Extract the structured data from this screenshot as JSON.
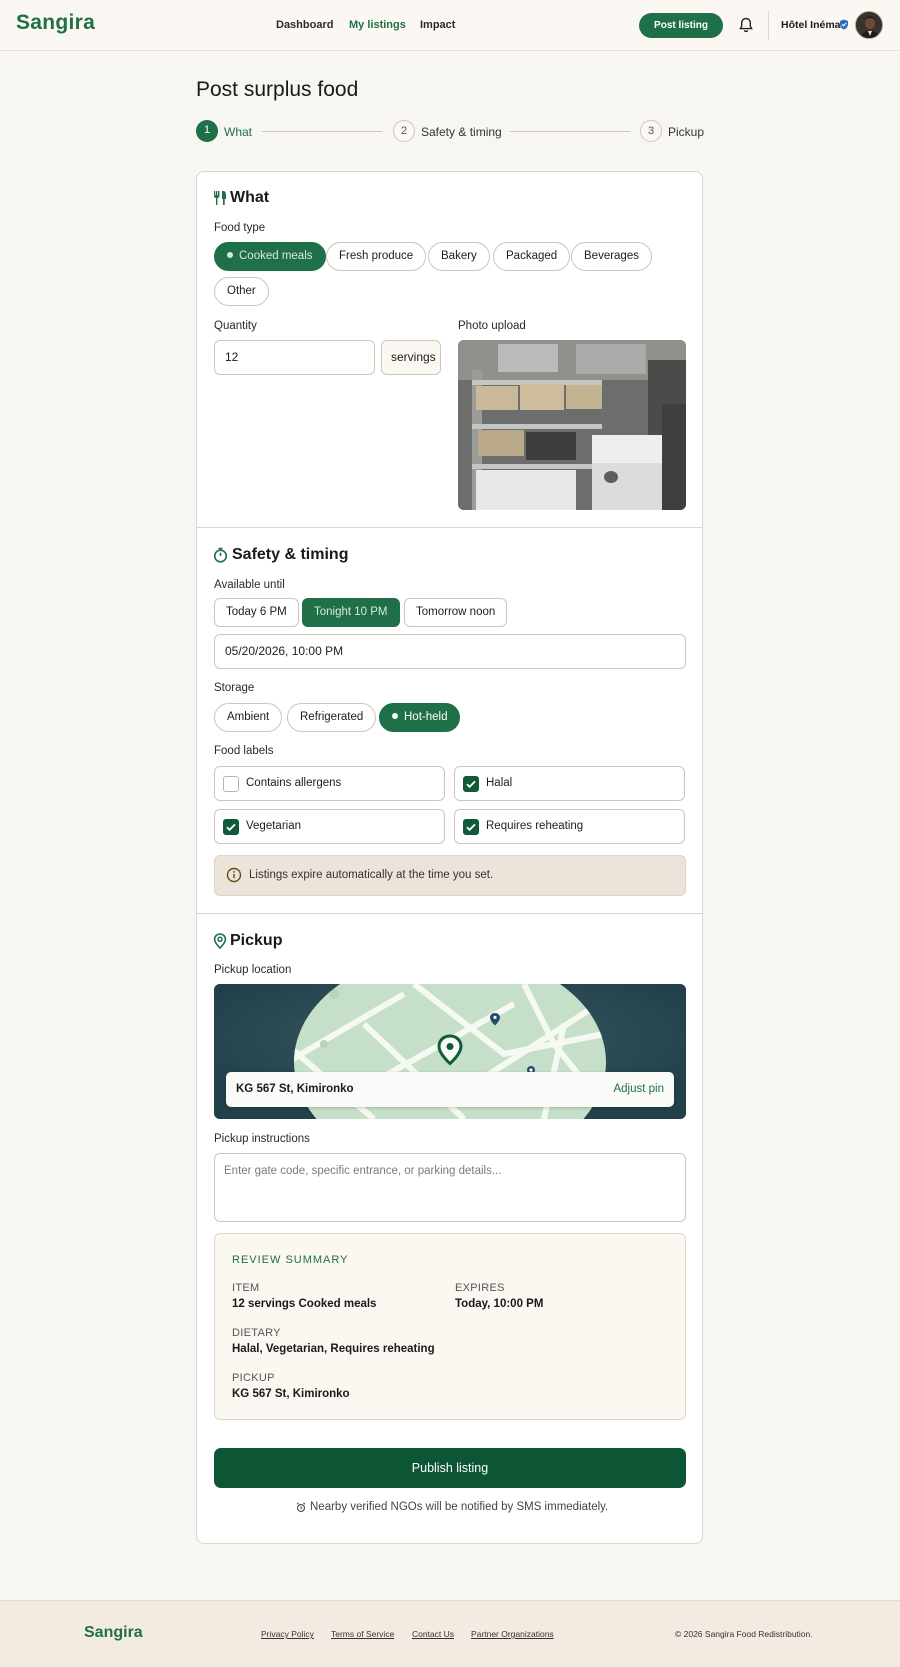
{
  "header": {
    "logo": "Sangira",
    "nav": [
      "Dashboard",
      "My listings",
      "Impact"
    ],
    "post_button": "Post listing",
    "org_name": "Hôtel Inéma",
    "bell_icon": "bell-icon",
    "verified_icon": "verified-badge-icon"
  },
  "page": {
    "title": "Post surplus food"
  },
  "steps": [
    {
      "num": "1",
      "label": "What"
    },
    {
      "num": "2",
      "label": "Safety & timing"
    },
    {
      "num": "3",
      "label": "Pickup"
    }
  ],
  "what": {
    "title": "What",
    "icon": "utensils-icon",
    "food_type_label": "Food type",
    "food_types": [
      "Cooked meals",
      "Fresh produce",
      "Bakery",
      "Packaged",
      "Beverages",
      "Other"
    ],
    "selected_food_type": "Cooked meals",
    "quantity_label": "Quantity",
    "quantity_value": "12",
    "quantity_unit": "servings",
    "photo_label": "Photo upload"
  },
  "safety": {
    "title": "Safety & timing",
    "icon": "stopwatch-icon",
    "available_label": "Available until",
    "time_options": [
      "Today 6 PM",
      "Tonight 10 PM",
      "Tomorrow noon"
    ],
    "selected_time": "Tonight 10 PM",
    "datetime_value": "05/20/2026, 10:00 PM",
    "storage_label": "Storage",
    "storage_options": [
      "Ambient",
      "Refrigerated",
      "Hot-held"
    ],
    "selected_storage": "Hot-held",
    "labels_label": "Food labels",
    "food_labels": [
      {
        "label": "Contains allergens",
        "checked": false
      },
      {
        "label": "Halal",
        "checked": true
      },
      {
        "label": "Vegetarian",
        "checked": true
      },
      {
        "label": "Requires reheating",
        "checked": true
      }
    ],
    "note": "Listings expire automatically at the time you set.",
    "note_icon": "info-icon"
  },
  "pickup": {
    "title": "Pickup",
    "icon": "map-pin-icon",
    "location_label": "Pickup location",
    "address": "KG 567 St, Kimironko",
    "adjust": "Adjust pin",
    "instructions_label": "Pickup instructions",
    "instructions_placeholder": "Enter gate code, specific entrance, or parking details..."
  },
  "review": {
    "heading": "REVIEW SUMMARY",
    "item_key": "ITEM",
    "item_value": "12 servings Cooked meals",
    "expires_key": "EXPIRES",
    "expires_value": "Today, 10:00 PM",
    "dietary_key": "DIETARY",
    "dietary_value": "Halal, Vegetarian, Requires reheating",
    "pickup_key": "PICKUP",
    "pickup_value": "KG 567 St, Kimironko"
  },
  "publish": {
    "button": "Publish listing",
    "hint": "Nearby verified NGOs will be notified by SMS immediately.",
    "hint_icon": "alarm-icon"
  },
  "footer": {
    "logo": "Sangira",
    "links": [
      "Privacy Policy",
      "Terms of Service",
      "Contact Us",
      "Partner Organizations"
    ],
    "copyright": "© 2026 Sangira Food Redistribution."
  },
  "colors": {
    "brand": "#1f6f48",
    "brand_dark": "#0c5535",
    "background": "#f8f6f2"
  }
}
